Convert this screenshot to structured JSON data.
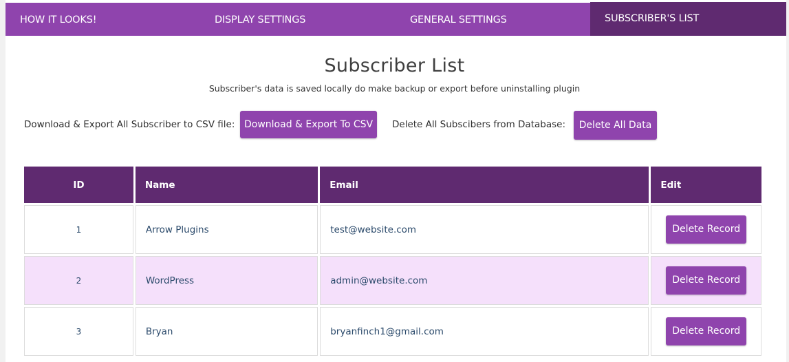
{
  "tabs": [
    {
      "label": "HOW IT LOOKS!",
      "active": false
    },
    {
      "label": "DISPLAY SETTINGS",
      "active": false
    },
    {
      "label": "GENERAL SETTINGS",
      "active": false
    },
    {
      "label": "SUBSCRIBER'S LIST",
      "active": true
    }
  ],
  "page": {
    "title": "Subscriber List",
    "subtitle": "Subscriber's data is saved locally do make backup or export before uninstalling plugin"
  },
  "actions": {
    "export_label": "Download & Export All Subscriber to CSV file:",
    "export_button": "Download & Export To CSV",
    "delete_label": "Delete All Subscibers from Database:",
    "delete_button": "Delete All Data"
  },
  "table": {
    "columns": [
      "ID",
      "Name",
      "Email",
      "Edit"
    ],
    "rows": [
      {
        "id": "1",
        "name": "Arrow Plugins",
        "email": "test@website.com",
        "action": "Delete Record"
      },
      {
        "id": "2",
        "name": "WordPress",
        "email": "admin@website.com",
        "action": "Delete Record"
      },
      {
        "id": "3",
        "name": "Bryan",
        "email": "bryanfinch1@gmail.com",
        "action": "Delete Record"
      }
    ]
  },
  "colors": {
    "tab_bar": "#8f44ad",
    "tab_active": "#5f2a70",
    "button": "#8f44ad",
    "table_header": "#5f2a70",
    "row_alt": "#f5e0fb"
  }
}
